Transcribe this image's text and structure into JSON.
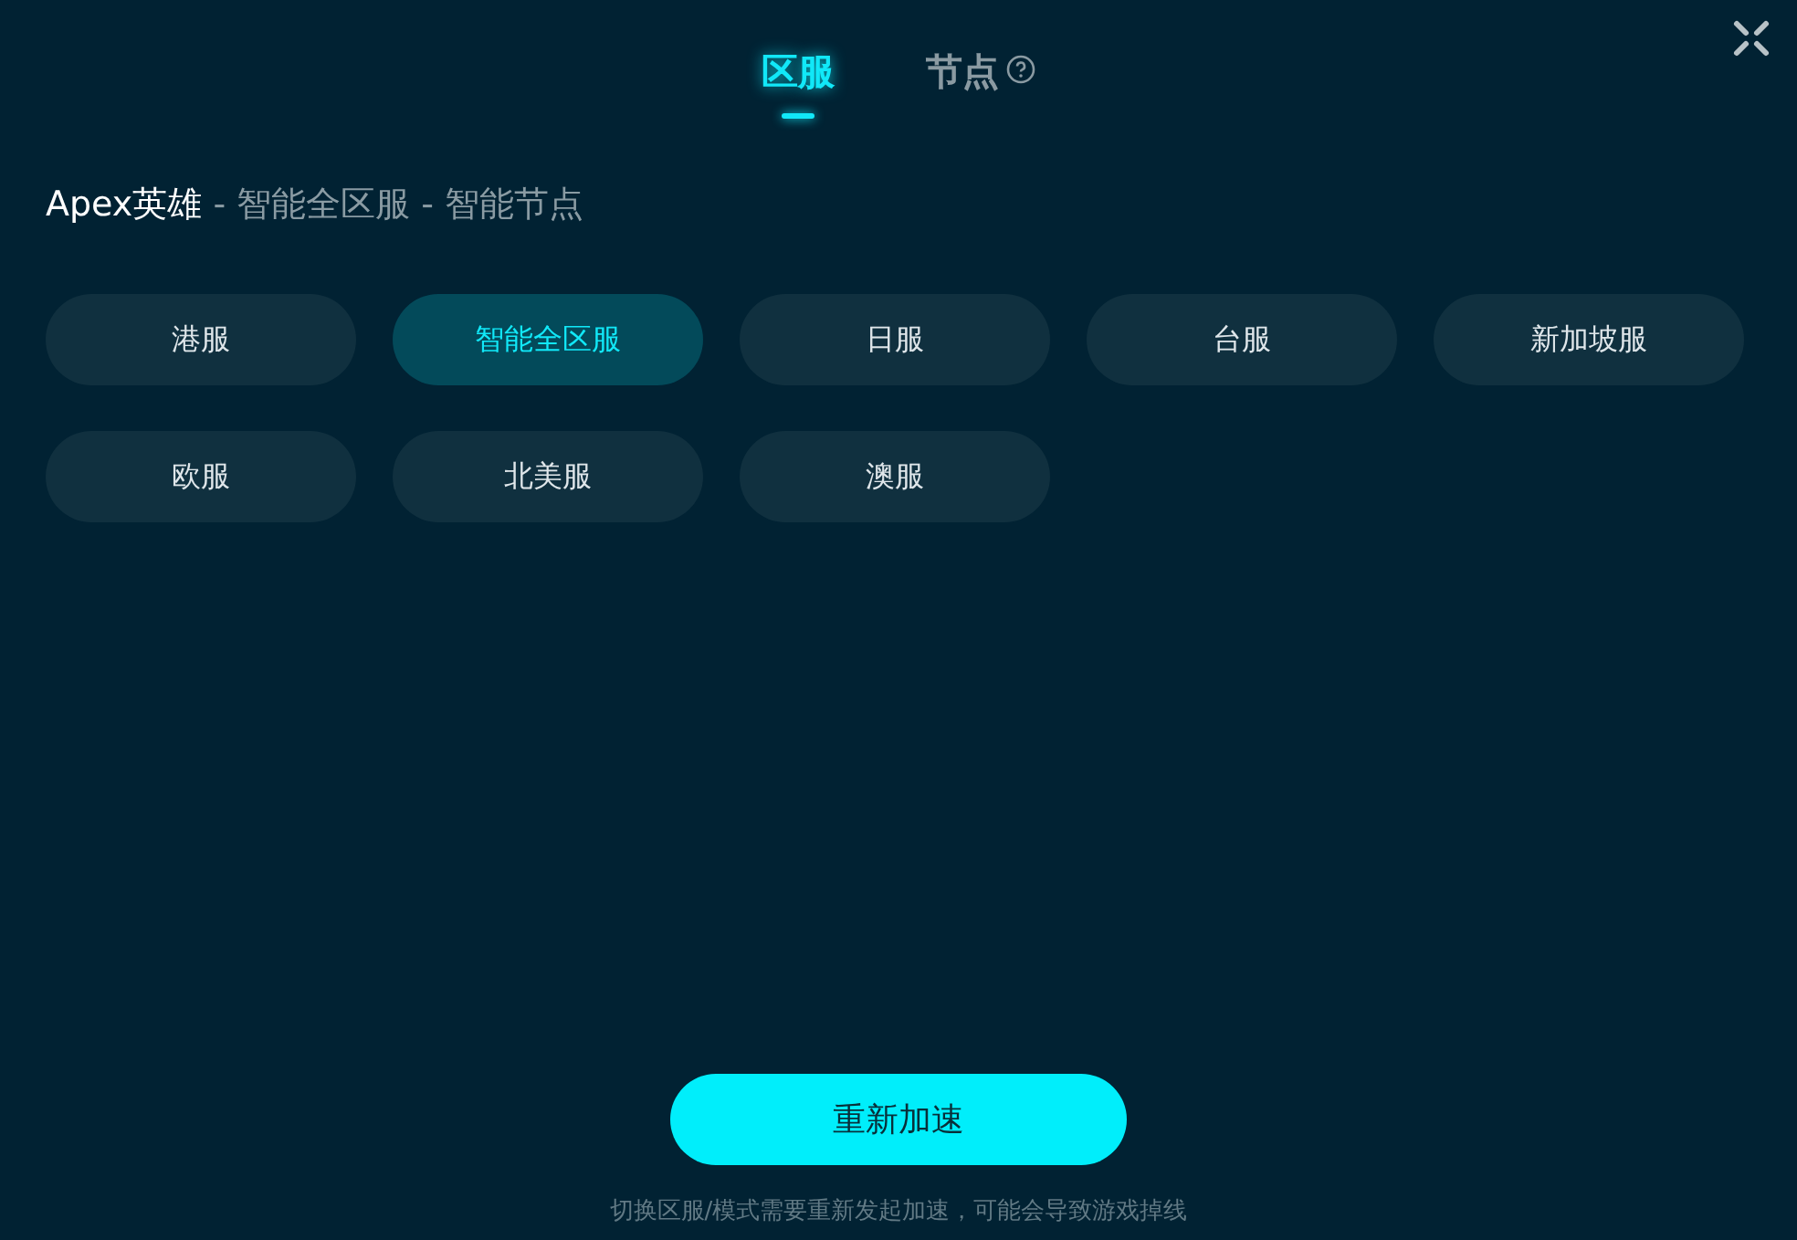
{
  "tabs": [
    {
      "label": "区服",
      "selected": true,
      "help": false
    },
    {
      "label": "节点",
      "selected": false,
      "help": true
    }
  ],
  "breadcrumb": {
    "game": "Apex英雄",
    "path": " - 智能全区服 - 智能节点"
  },
  "regions": [
    {
      "label": "港服",
      "selected": false
    },
    {
      "label": "智能全区服",
      "selected": true
    },
    {
      "label": "日服",
      "selected": false
    },
    {
      "label": "台服",
      "selected": false
    },
    {
      "label": "新加坡服",
      "selected": false
    },
    {
      "label": "欧服",
      "selected": false
    },
    {
      "label": "北美服",
      "selected": false
    },
    {
      "label": "澳服",
      "selected": false
    }
  ],
  "action_button": "重新加速",
  "notice": "切换区服/模式需要重新发起加速，可能会导致游戏掉线"
}
